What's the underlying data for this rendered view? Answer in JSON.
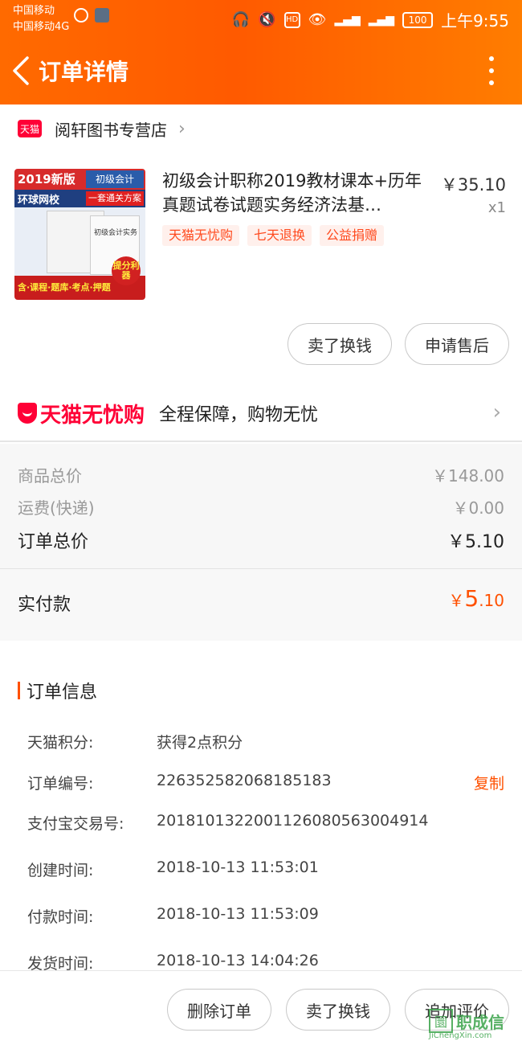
{
  "status_bar": {
    "carrier1": "中国移动",
    "carrier2": "中国移动4G",
    "hd": "HD",
    "battery": "100",
    "time": "上午9:55"
  },
  "header": {
    "title": "订单详情"
  },
  "shop": {
    "badge": "天猫",
    "name": "阅轩图书专营店"
  },
  "product": {
    "title": "初级会计职称2019教材课本+历年真题试卷试题实务经济法基…",
    "price": "￥35.10",
    "quantity": "x1",
    "tags": [
      "天猫无忧购",
      "七天退换",
      "公益捐赠"
    ],
    "cover": {
      "top_left": "2019新版",
      "top_right": "初级会计",
      "second_left": "环球网校",
      "second_right": "一套通关方案",
      "book_text": "初级会计实务",
      "bottom": "含·课程·题库·考点·押题",
      "seal": "提分利器"
    }
  },
  "item_actions": {
    "sell": "卖了换钱",
    "after_sale": "申请售后"
  },
  "assurance": {
    "logo": "天猫无忧购",
    "text": "全程保障，购物无忧"
  },
  "summary": {
    "goods_label": "商品总价",
    "goods_value": "￥148.00",
    "shipping_label": "运费(快递)",
    "shipping_value": "￥0.00",
    "total_label": "订单总价",
    "total_value": "￥5.10",
    "paid_label": "实付款",
    "paid_currency": "￥",
    "paid_int": "5",
    "paid_dec": ".10"
  },
  "order_info": {
    "title": "订单信息",
    "rows": [
      {
        "k": "天猫积分:",
        "v": "获得2点积分"
      },
      {
        "k": "订单编号:",
        "v": "226352582068185183"
      },
      {
        "k": "支付宝交易号:",
        "v": "2018101322001126080563004914"
      },
      {
        "k": "创建时间:",
        "v": "2018-10-13 11:53:01"
      },
      {
        "k": "付款时间:",
        "v": "2018-10-13 11:53:09"
      },
      {
        "k": "发货时间:",
        "v": "2018-10-13 14:04:26"
      }
    ],
    "copy": "复制"
  },
  "bottom_actions": {
    "delete": "删除订单",
    "sell": "卖了换钱",
    "review": "追加评价"
  },
  "watermark": {
    "box": "圜",
    "text": "职成信",
    "sub": "JiChengXin.com"
  },
  "colors": {
    "header_start": "#ff6a00",
    "accent": "#ff5000",
    "tmall_red": "#ff0036"
  }
}
